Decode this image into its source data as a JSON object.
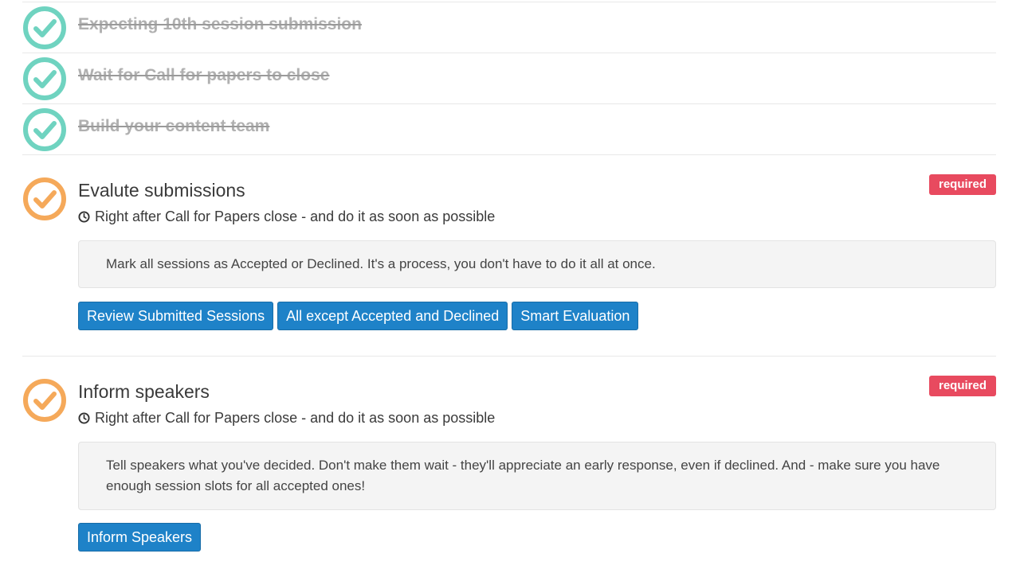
{
  "completed_steps": [
    {
      "title": "Expecting 10th session submission"
    },
    {
      "title": "Wait for Call for papers to close"
    },
    {
      "title": "Build your content team"
    }
  ],
  "tasks": [
    {
      "title": "Evalute submissions",
      "badge": "required",
      "timing": "Right after Call for Papers close - and do it as soon as possible",
      "note": "Mark all sessions as Accepted or Declined. It's a process, you don't have to do it all at once.",
      "buttons": [
        "Review Submitted Sessions",
        "All except Accepted and Declined",
        "Smart Evaluation"
      ]
    },
    {
      "title": "Inform speakers",
      "badge": "required",
      "timing": "Right after Call for Papers close - and do it as soon as possible",
      "note": "Tell speakers what you've decided. Don't make them wait - they'll appreciate an early response, even if declined. And - make sure you have enough session slots for all accepted ones!",
      "buttons": [
        "Inform Speakers"
      ]
    }
  ],
  "colors": {
    "done": "#6fd3c0",
    "pending": "#f5a95a",
    "required_badge": "#e84a5f",
    "button": "#1e82c8"
  },
  "icons": {
    "done": "check-circle-icon",
    "pending": "check-circle-icon",
    "timing": "clock-icon"
  }
}
